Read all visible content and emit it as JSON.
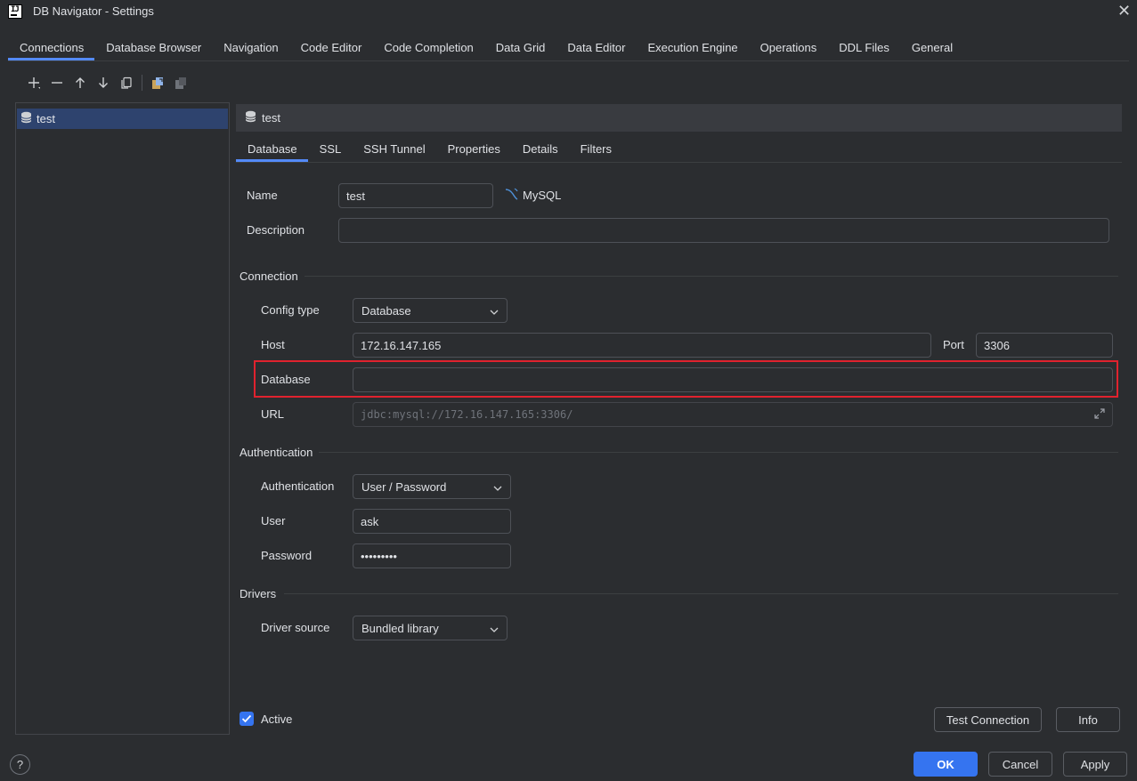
{
  "window": {
    "title": "DB Navigator - Settings",
    "close_glyph": "✕"
  },
  "top_tabs": [
    {
      "label": "Connections",
      "active": true
    },
    {
      "label": "Database Browser"
    },
    {
      "label": "Navigation"
    },
    {
      "label": "Code Editor"
    },
    {
      "label": "Code Completion"
    },
    {
      "label": "Data Grid"
    },
    {
      "label": "Data Editor"
    },
    {
      "label": "Execution Engine"
    },
    {
      "label": "Operations"
    },
    {
      "label": "DDL Files"
    },
    {
      "label": "General"
    }
  ],
  "toolbar": {
    "icons": [
      "add-icon",
      "remove-icon",
      "move-up-icon",
      "move-down-icon",
      "copy-icon",
      "export-icon",
      "import-icon"
    ]
  },
  "connection_list": {
    "items": [
      {
        "label": "test",
        "icon": "database-icon",
        "selected": true
      }
    ]
  },
  "detail": {
    "header_label": "test",
    "tabs": [
      {
        "label": "Database",
        "active": true
      },
      {
        "label": "SSL"
      },
      {
        "label": "SSH Tunnel"
      },
      {
        "label": "Properties"
      },
      {
        "label": "Details"
      },
      {
        "label": "Filters"
      }
    ],
    "name_label": "Name",
    "name_value": "test",
    "db_type": "MySQL",
    "description_label": "Description",
    "description_value": "",
    "connection_section": "Connection",
    "config_type_label": "Config type",
    "config_type_value": "Database",
    "host_label": "Host",
    "host_value": "172.16.147.165",
    "port_label": "Port",
    "port_value": "3306",
    "database_label": "Database",
    "database_value": "",
    "url_label": "URL",
    "url_value": "jdbc:mysql://172.16.147.165:3306/",
    "auth_section": "Authentication",
    "auth_label": "Authentication",
    "auth_value": "User / Password",
    "user_label": "User",
    "user_value": "ask",
    "password_label": "Password",
    "password_value": "•••••••••",
    "drivers_section": "Drivers",
    "driver_source_label": "Driver source",
    "driver_source_value": "Bundled library",
    "active_label": "Active",
    "active_checked": true,
    "test_connection_label": "Test Connection",
    "info_label": "Info"
  },
  "footer": {
    "help_label": "?",
    "ok_label": "OK",
    "cancel_label": "Cancel",
    "apply_label": "Apply"
  },
  "colors": {
    "accent": "#3574f0",
    "highlight_border": "#e0222e",
    "selection": "#2e436e"
  }
}
